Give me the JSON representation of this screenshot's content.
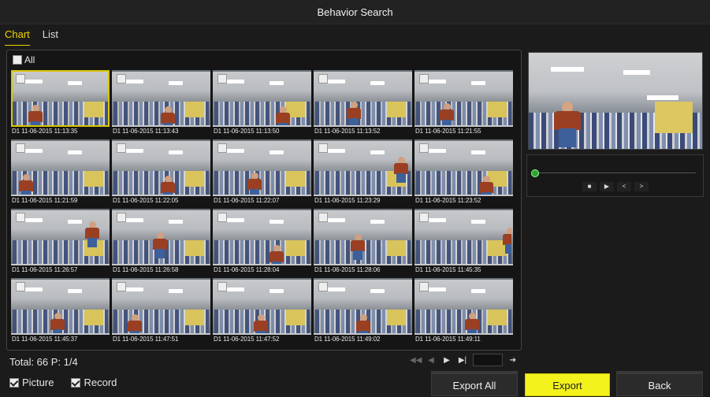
{
  "window": {
    "title": "Behavior Search"
  },
  "tabs": [
    {
      "label": "Chart",
      "active": true
    },
    {
      "label": "List",
      "active": false
    }
  ],
  "select_all": {
    "label": "All",
    "checked": false
  },
  "results": [
    {
      "time": "D1 11-06-2015 11:13:35",
      "selected": true
    },
    {
      "time": "D1 11-06-2015 11:13:43"
    },
    {
      "time": "D1 11-06-2015 11:13:50"
    },
    {
      "time": "D1 11-06-2015 11:13:52"
    },
    {
      "time": "D1 11-06-2015 11:21:55"
    },
    {
      "time": "D1 11-06-2015 11:21:59"
    },
    {
      "time": "D1 11-06-2015 11:22:05"
    },
    {
      "time": "D1 11-06-2015 11:22:07"
    },
    {
      "time": "D1 11-06-2015 11:23:29"
    },
    {
      "time": "D1 11-06-2015 11:23:52"
    },
    {
      "time": "D1 11-06-2015 11:26:57"
    },
    {
      "time": "D1 11-06-2015 11:26:58"
    },
    {
      "time": "D1 11-06-2015 11:28:04"
    },
    {
      "time": "D1 11-06-2015 11:28:06"
    },
    {
      "time": "D1 11-06-2015 11:45:35"
    },
    {
      "time": "D1 11-06-2015 11:45:37"
    },
    {
      "time": "D1 11-06-2015 11:47:51"
    },
    {
      "time": "D1 11-06-2015 11:47:52"
    },
    {
      "time": "D1 11-06-2015 11:49:02"
    },
    {
      "time": "D1 11-06-2015 11:49:11"
    }
  ],
  "status": {
    "text": "Total: 66  P: 1/4"
  },
  "pager": {
    "first": "◀◀",
    "prev": "◀",
    "next": "▶",
    "last": "▶|",
    "go": "➔"
  },
  "player": {
    "stop": "■",
    "play": "▶",
    "prev": "<",
    "next": ">"
  },
  "options": {
    "picture_label": "Picture",
    "picture_checked": true,
    "record_label": "Record",
    "record_checked": true
  },
  "buttons": {
    "export_all": "Export All",
    "export": "Export",
    "back": "Back"
  },
  "colors": {
    "accent": "#f3f21c",
    "selection": "#d8c600",
    "background": "#1b1b1b"
  }
}
